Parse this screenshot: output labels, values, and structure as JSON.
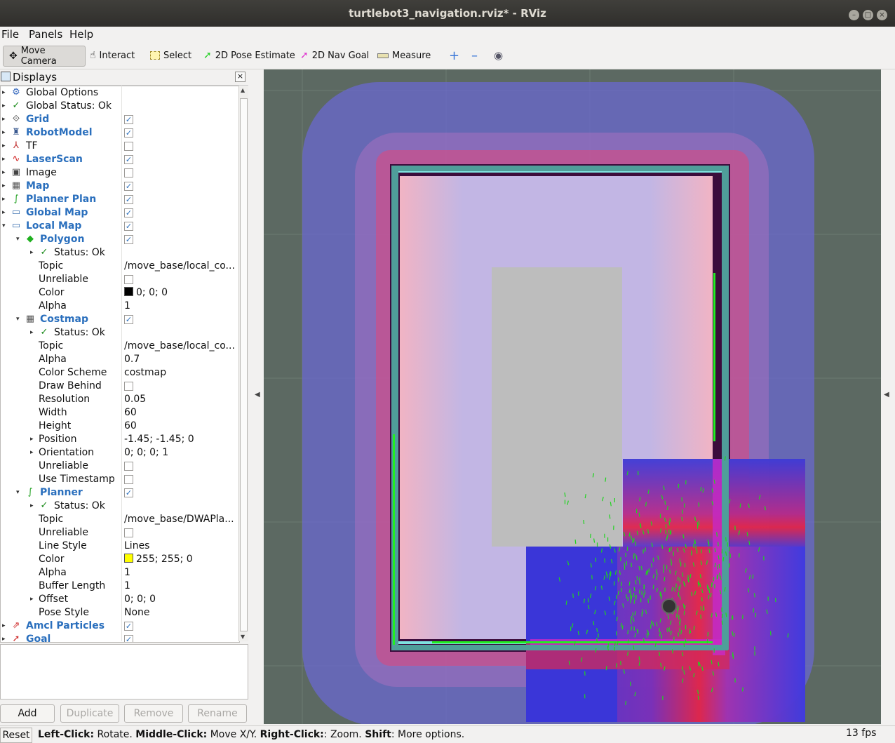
{
  "window": {
    "title": "turtlebot3_navigation.rviz* - RViz"
  },
  "menu": [
    "File",
    "Panels",
    "Help"
  ],
  "toolbar": {
    "move_camera": "Move Camera",
    "interact": "Interact",
    "select": "Select",
    "pose_estimate": "2D Pose Estimate",
    "nav_goal": "2D Nav Goal",
    "measure": "Measure"
  },
  "displays_panel": {
    "title": "Displays",
    "rows": [
      {
        "name": "Global Options",
        "icon": "gear-icon"
      },
      {
        "name": "Global Status: Ok",
        "icon": "check-icon"
      },
      {
        "name": "Grid",
        "checked": true,
        "icon": "grid-icon"
      },
      {
        "name": "RobotModel",
        "checked": true,
        "icon": "robot-icon"
      },
      {
        "name": "TF",
        "checked": false,
        "icon": "axes-icon"
      },
      {
        "name": "LaserScan",
        "checked": true,
        "icon": "laser-icon"
      },
      {
        "name": "Image",
        "checked": false,
        "icon": "image-icon"
      },
      {
        "name": "Map",
        "checked": true,
        "icon": "map-icon"
      },
      {
        "name": "Planner Plan",
        "checked": true,
        "icon": "path-icon"
      },
      {
        "name": "Global Map",
        "checked": true,
        "icon": "folder-icon"
      },
      {
        "name": "Local Map",
        "checked": true,
        "icon": "folder-icon"
      },
      {
        "name": "Polygon",
        "checked": true,
        "icon": "polygon-icon"
      },
      {
        "name": "Status: Ok",
        "icon": "check-icon"
      },
      {
        "name": "Topic",
        "value": "/move_base/local_co..."
      },
      {
        "name": "Unreliable",
        "checked": false
      },
      {
        "name": "Color",
        "value": "0; 0; 0",
        "color": "#000000"
      },
      {
        "name": "Alpha",
        "value": "1"
      },
      {
        "name": "Costmap",
        "checked": true,
        "icon": "map-icon"
      },
      {
        "name": "Status: Ok",
        "icon": "check-icon"
      },
      {
        "name": "Topic",
        "value": "/move_base/local_co..."
      },
      {
        "name": "Alpha",
        "value": "0.7"
      },
      {
        "name": "Color Scheme",
        "value": "costmap"
      },
      {
        "name": "Draw Behind",
        "checked": false
      },
      {
        "name": "Resolution",
        "value": "0.05"
      },
      {
        "name": "Width",
        "value": "60"
      },
      {
        "name": "Height",
        "value": "60"
      },
      {
        "name": "Position",
        "value": "-1.45; -1.45; 0"
      },
      {
        "name": "Orientation",
        "value": "0; 0; 0; 1"
      },
      {
        "name": "Unreliable",
        "checked": false
      },
      {
        "name": "Use Timestamp",
        "checked": false
      },
      {
        "name": "Planner",
        "checked": true,
        "icon": "path-icon"
      },
      {
        "name": "Status: Ok",
        "icon": "check-icon"
      },
      {
        "name": "Topic",
        "value": "/move_base/DWAPla..."
      },
      {
        "name": "Unreliable",
        "checked": false
      },
      {
        "name": "Line Style",
        "value": "Lines"
      },
      {
        "name": "Color",
        "value": "255; 255; 0",
        "color": "#ffff00"
      },
      {
        "name": "Alpha",
        "value": "1"
      },
      {
        "name": "Buffer Length",
        "value": "1"
      },
      {
        "name": "Offset",
        "value": "0; 0; 0"
      },
      {
        "name": "Pose Style",
        "value": "None"
      },
      {
        "name": "Amcl Particles",
        "checked": true,
        "icon": "particles-icon"
      },
      {
        "name": "Goal",
        "checked": true,
        "icon": "goal-icon"
      }
    ]
  },
  "panel_buttons": {
    "add": "Add",
    "duplicate": "Duplicate",
    "remove": "Remove",
    "rename": "Rename"
  },
  "status_bar": {
    "reset": "Reset",
    "help": [
      {
        "b": "Left-Click:",
        "t": " Rotate. "
      },
      {
        "b": "Middle-Click:",
        "t": " Move X/Y. "
      },
      {
        "b": "Right-Click:",
        "t": ": Zoom. "
      },
      {
        "b": "Shift",
        "t": ": More options."
      }
    ],
    "fps": "13 fps"
  },
  "colors": {
    "grid_bg": "#5c6962",
    "category_text": "#2a6fbd",
    "costmap_blue": "#3a36d8",
    "particles": "#22cc22"
  }
}
